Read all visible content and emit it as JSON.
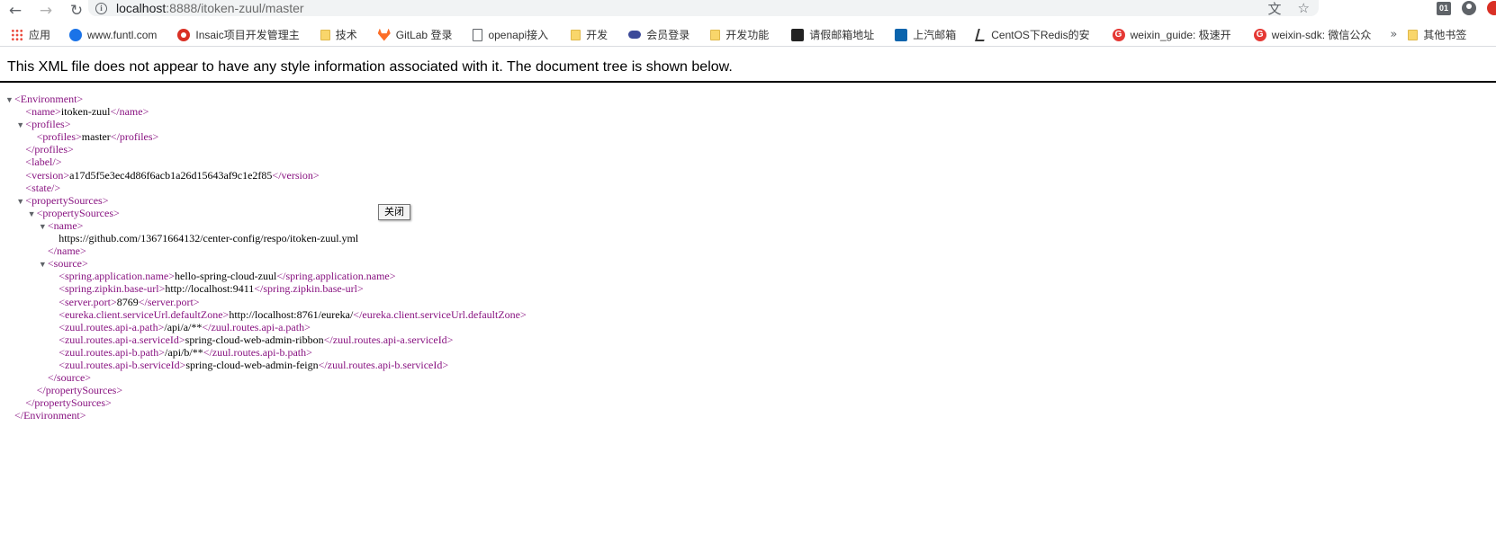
{
  "toolbar": {
    "url_host": "localhost",
    "url_path": ":8888/itoken-zuul/master",
    "extension_badge": "01"
  },
  "bookmarks": [
    {
      "label": "应用",
      "icon": "apps-grid-icon"
    },
    {
      "label": "www.funtl.com",
      "icon": "globe-icon"
    },
    {
      "label": "Insaic项目开发管理主",
      "icon": "red-logo-icon"
    },
    {
      "label": "技术",
      "icon": "folder-icon"
    },
    {
      "label": "GitLab 登录",
      "icon": "gitlab-icon"
    },
    {
      "label": "openapi接入",
      "icon": "document-icon"
    },
    {
      "label": "开发",
      "icon": "folder-icon"
    },
    {
      "label": "会员登录",
      "icon": "cloud-icon"
    },
    {
      "label": "开发功能",
      "icon": "folder-icon"
    },
    {
      "label": "请假邮箱地址",
      "icon": "wechat-icon"
    },
    {
      "label": "上汽邮箱",
      "icon": "outlook-icon"
    },
    {
      "label": "CentOS下Redis的安",
      "icon": "redis-icon"
    },
    {
      "label": "weixin_guide: 极速开",
      "icon": "weixin-icon"
    },
    {
      "label": "weixin-sdk: 微信公众",
      "icon": "weixin-icon"
    }
  ],
  "bookmarks_more": "»",
  "other_bookmarks": "其他书签",
  "xml_notice": "This XML file does not appear to have any style information associated with it. The document tree is shown below.",
  "tooltip": "关闭",
  "tree": [
    {
      "indent": 0,
      "toggle": true,
      "parts": [
        [
          "tag",
          "<Environment>"
        ]
      ]
    },
    {
      "indent": 1,
      "toggle": false,
      "parts": [
        [
          "tag",
          "<name>"
        ],
        [
          "txt",
          "itoken-zuul"
        ],
        [
          "tag",
          "</name>"
        ]
      ]
    },
    {
      "indent": 1,
      "toggle": true,
      "parts": [
        [
          "tag",
          "<profiles>"
        ]
      ]
    },
    {
      "indent": 2,
      "toggle": false,
      "parts": [
        [
          "tag",
          "<profiles>"
        ],
        [
          "txt",
          "master"
        ],
        [
          "tag",
          "</profiles>"
        ]
      ]
    },
    {
      "indent": 1,
      "toggle": false,
      "parts": [
        [
          "tag",
          "</profiles>"
        ]
      ]
    },
    {
      "indent": 1,
      "toggle": false,
      "parts": [
        [
          "tag",
          "<label/>"
        ]
      ]
    },
    {
      "indent": 1,
      "toggle": false,
      "parts": [
        [
          "tag",
          "<version>"
        ],
        [
          "txt",
          "a17d5f5e3ec4d86f6acb1a26d15643af9c1e2f85"
        ],
        [
          "tag",
          "</version>"
        ]
      ]
    },
    {
      "indent": 1,
      "toggle": false,
      "parts": [
        [
          "tag",
          "<state/>"
        ]
      ]
    },
    {
      "indent": 1,
      "toggle": true,
      "parts": [
        [
          "tag",
          "<propertySources>"
        ]
      ]
    },
    {
      "indent": 2,
      "toggle": true,
      "parts": [
        [
          "tag",
          "<propertySources>"
        ]
      ]
    },
    {
      "indent": 3,
      "toggle": true,
      "parts": [
        [
          "tag",
          "<name>"
        ]
      ]
    },
    {
      "indent": 4,
      "toggle": false,
      "parts": [
        [
          "txt",
          "https://github.com/13671664132/center-config/respo/itoken-zuul.yml"
        ]
      ]
    },
    {
      "indent": 3,
      "toggle": false,
      "parts": [
        [
          "tag",
          "</name>"
        ]
      ]
    },
    {
      "indent": 3,
      "toggle": true,
      "parts": [
        [
          "tag",
          "<source>"
        ]
      ]
    },
    {
      "indent": 4,
      "toggle": false,
      "parts": [
        [
          "tag",
          "<spring.application.name>"
        ],
        [
          "txt",
          "hello-spring-cloud-zuul"
        ],
        [
          "tag",
          "</spring.application.name>"
        ]
      ]
    },
    {
      "indent": 4,
      "toggle": false,
      "parts": [
        [
          "tag",
          "<spring.zipkin.base-url>"
        ],
        [
          "txt",
          "http://localhost:9411"
        ],
        [
          "tag",
          "</spring.zipkin.base-url>"
        ]
      ]
    },
    {
      "indent": 4,
      "toggle": false,
      "parts": [
        [
          "tag",
          "<server.port>"
        ],
        [
          "txt",
          "8769"
        ],
        [
          "tag",
          "</server.port>"
        ]
      ]
    },
    {
      "indent": 4,
      "toggle": false,
      "parts": [
        [
          "tag",
          "<eureka.client.serviceUrl.defaultZone>"
        ],
        [
          "txt",
          "http://localhost:8761/eureka/"
        ],
        [
          "tag",
          "</eureka.client.serviceUrl.defaultZone>"
        ]
      ]
    },
    {
      "indent": 4,
      "toggle": false,
      "parts": [
        [
          "tag",
          "<zuul.routes.api-a.path>"
        ],
        [
          "txt",
          "/api/a/**"
        ],
        [
          "tag",
          "</zuul.routes.api-a.path>"
        ]
      ]
    },
    {
      "indent": 4,
      "toggle": false,
      "parts": [
        [
          "tag",
          "<zuul.routes.api-a.serviceId>"
        ],
        [
          "txt",
          "spring-cloud-web-admin-ribbon"
        ],
        [
          "tag",
          "</zuul.routes.api-a.serviceId>"
        ]
      ]
    },
    {
      "indent": 4,
      "toggle": false,
      "parts": [
        [
          "tag",
          "<zuul.routes.api-b.path>"
        ],
        [
          "txt",
          "/api/b/**"
        ],
        [
          "tag",
          "</zuul.routes.api-b.path>"
        ]
      ]
    },
    {
      "indent": 4,
      "toggle": false,
      "parts": [
        [
          "tag",
          "<zuul.routes.api-b.serviceId>"
        ],
        [
          "txt",
          "spring-cloud-web-admin-feign"
        ],
        [
          "tag",
          "</zuul.routes.api-b.serviceId>"
        ]
      ]
    },
    {
      "indent": 3,
      "toggle": false,
      "parts": [
        [
          "tag",
          "</source>"
        ]
      ]
    },
    {
      "indent": 2,
      "toggle": false,
      "parts": [
        [
          "tag",
          "</propertySources>"
        ]
      ]
    },
    {
      "indent": 1,
      "toggle": false,
      "parts": [
        [
          "tag",
          "</propertySources>"
        ]
      ]
    },
    {
      "indent": 0,
      "toggle": false,
      "parts": [
        [
          "tag",
          "</Environment>"
        ]
      ]
    }
  ]
}
